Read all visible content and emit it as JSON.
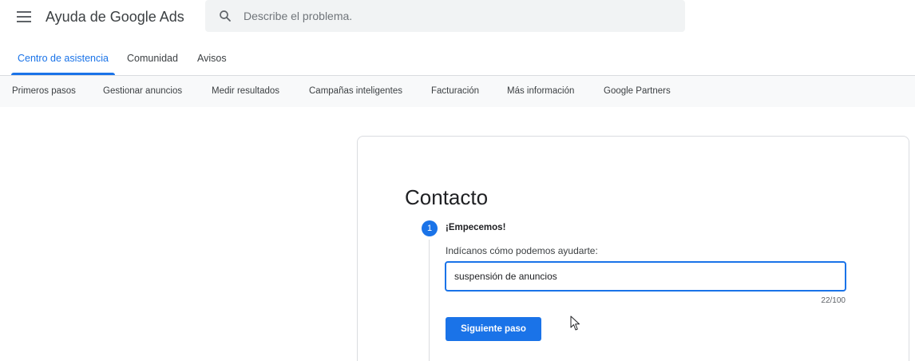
{
  "header": {
    "app_title": "Ayuda de Google Ads",
    "menu_icon": "hamburger-menu-icon",
    "search": {
      "icon": "search-icon",
      "placeholder": "Describe el problema.",
      "value": ""
    }
  },
  "tabs": [
    {
      "label": "Centro de asistencia",
      "active": true
    },
    {
      "label": "Comunidad",
      "active": false
    },
    {
      "label": "Avisos",
      "active": false
    }
  ],
  "subnav": [
    {
      "label": "Primeros pasos"
    },
    {
      "label": "Gestionar anuncios"
    },
    {
      "label": "Medir resultados"
    },
    {
      "label": "Campañas inteligentes"
    },
    {
      "label": "Facturación"
    },
    {
      "label": "Más información"
    },
    {
      "label": "Google Partners"
    }
  ],
  "contact": {
    "title": "Contacto",
    "step_number": "1",
    "step_label": "¡Empecemos!",
    "field_label": "Indícanos cómo podemos ayudarte:",
    "field_value": "suspensión de anuncios",
    "char_count": "22/100",
    "next_button": "Siguiente paso"
  },
  "colors": {
    "accent": "#1a73e8",
    "subnav_bg": "#f8f9fa",
    "search_bg": "#f1f3f4",
    "border": "#dadce0"
  }
}
